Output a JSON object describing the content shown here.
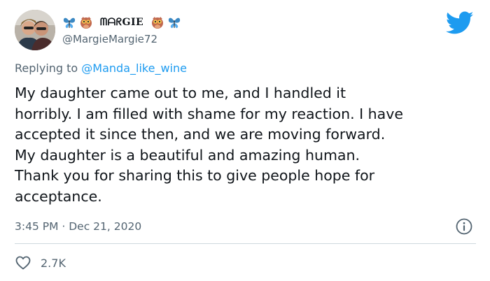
{
  "author": {
    "display_name": "ᗰᗩᖇGIE",
    "handle": "@MargieMargie72",
    "name_decorations": [
      "butterfly-icon",
      "owl-icon",
      "owl-icon",
      "butterfly-icon"
    ]
  },
  "brand_icon": "twitter-bird-icon",
  "reply": {
    "prefix": "Replying to",
    "mention": "@Manda_like_wine"
  },
  "tweet": {
    "text": "My daughter came out to me, and I handled it\nhorribly. I am filled with shame for my reaction. I have\naccepted it since then, and we are moving forward.\nMy daughter is a beautiful and amazing human.\nThank you for sharing this to give people hope for\nacceptance.",
    "timestamp": "3:45 PM · Dec 21, 2020"
  },
  "stats": {
    "likes": "2.7K"
  },
  "colors": {
    "accent": "#1d9bf0",
    "secondary_text": "#536471",
    "divider": "#cfd9de"
  }
}
